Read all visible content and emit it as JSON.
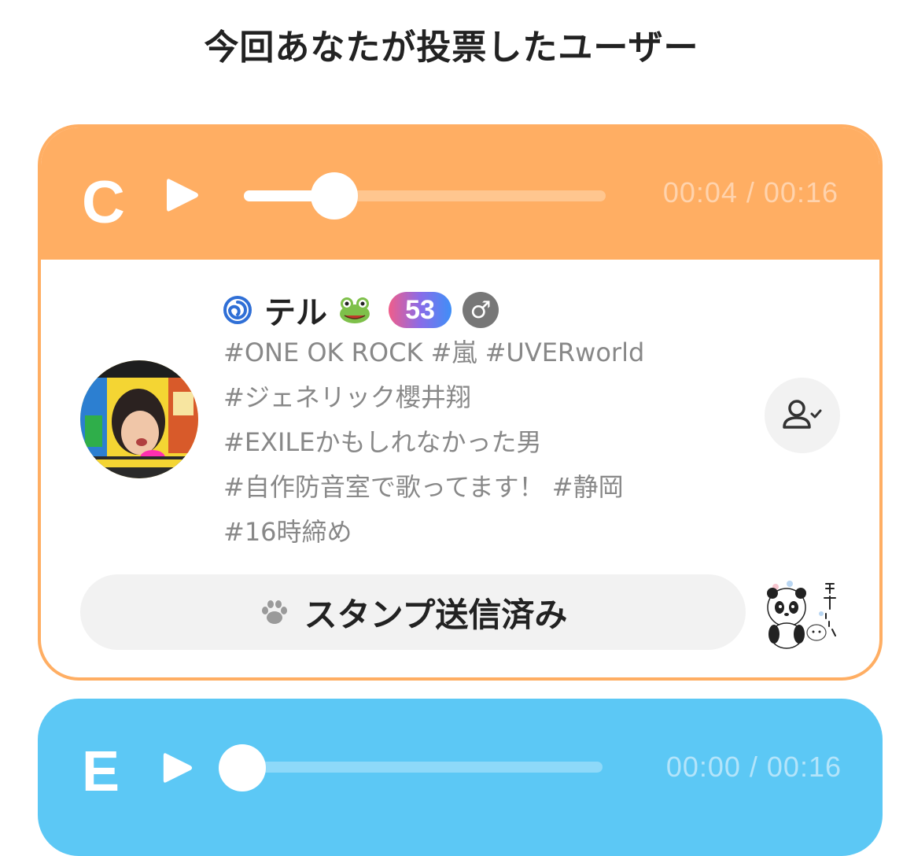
{
  "page": {
    "title": "今回あなたが投票したユーザー"
  },
  "cards": [
    {
      "grade": "C",
      "accent_color": "#ffae63",
      "player": {
        "progress": 0.25,
        "time": "00:04 / 00:16"
      },
      "user": {
        "name": "テル",
        "level": "53",
        "gender": "♂",
        "name_icons": [
          "swirl-icon",
          "frog-icon"
        ],
        "tag_lines": [
          "#ONE OK ROCK #嵐 #UVERworld",
          "#ジェネリック櫻井翔",
          "#EXILEかもしれなかった男",
          "#自作防音室で歌ってます！ #静岡",
          "#16時締め"
        ]
      },
      "stamp_button_label": "スタンプ送信済み"
    },
    {
      "grade": "E",
      "accent_color": "#5cc8f5",
      "player": {
        "progress": 0.0,
        "time": "00:00 / 00:16"
      }
    }
  ]
}
